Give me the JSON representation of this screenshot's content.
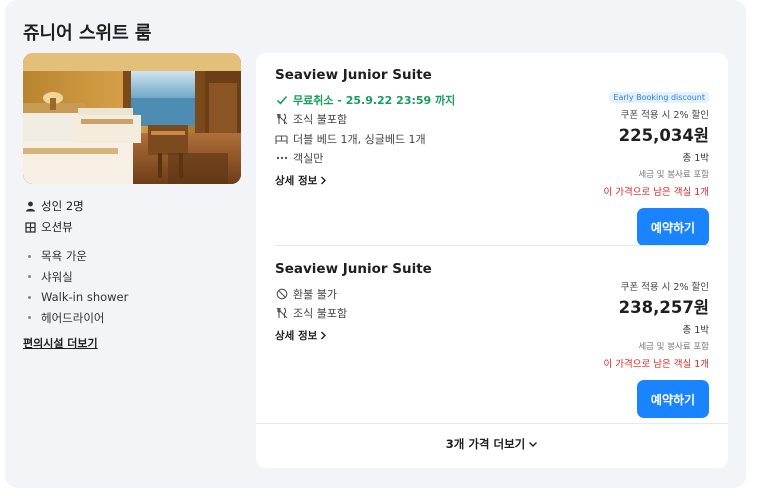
{
  "room": {
    "title": "쥬니어 스위트 룸",
    "guests": "성인 2명",
    "view": "오션뷰",
    "amenities": [
      "목욕 가운",
      "샤워실",
      "Walk-in shower",
      "헤어드라이어"
    ],
    "more_amenities_link": "편의시설 더보기"
  },
  "offers": [
    {
      "name": "Seaview Junior Suite",
      "features": [
        {
          "icon": "check-icon",
          "text": "무료취소 - 25.9.22 23:59 까지",
          "highlight": true
        },
        {
          "icon": "utensils-icon",
          "text": "조식 불포함"
        },
        {
          "icon": "bed-icon",
          "text": "더블 베드 1개, 싱글베드 1개"
        },
        {
          "icon": "ellipsis-icon",
          "text": "객실만"
        }
      ],
      "details_label": "상세 정보",
      "badge": "Early Booking discount",
      "coupon": "쿠폰 적용 시 2% 할인",
      "price": "225,034원",
      "nights": "총 1박",
      "tax": "세금 및 봉사료 포함",
      "remaining": "이 가격으로 남은 객실 1개",
      "book_label": "예약하기"
    },
    {
      "name": "Seaview Junior Suite",
      "features": [
        {
          "icon": "no-refund-icon",
          "text": "환불 불가"
        },
        {
          "icon": "utensils-icon",
          "text": "조식 불포함"
        }
      ],
      "details_label": "상세 정보",
      "coupon": "쿠폰 적용 시 2% 할인",
      "price": "238,257원",
      "nights": "총 1박",
      "tax": "세금 및 봉사료 포함",
      "remaining": "이 가격으로 남은 객실 1개",
      "book_label": "예약하기"
    }
  ],
  "more_prices": "3개 가격 더보기",
  "colors": {
    "accent": "#1a84ff",
    "green": "#1a9c5b",
    "red": "#e02828",
    "badge_bg": "#e5f1ff",
    "panel_bg": "#f3f4f7"
  }
}
